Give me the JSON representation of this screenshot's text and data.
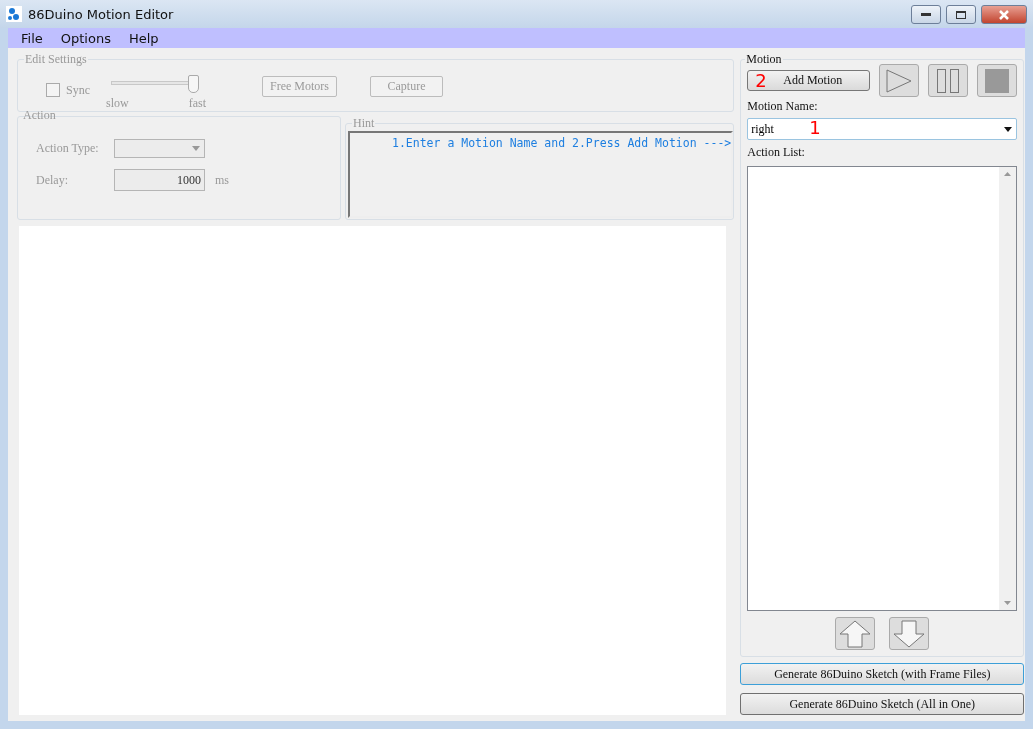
{
  "window": {
    "title": "86Duino Motion Editor"
  },
  "menu": [
    "File",
    "Options",
    "Help"
  ],
  "edit_settings": {
    "title": "Edit Settings",
    "sync": {
      "label": "Sync",
      "checked": false
    },
    "speed": {
      "level": 0.98,
      "min_label": "slow",
      "max_label": "fast"
    },
    "buttons": [
      "Free Motors",
      "Capture"
    ]
  },
  "action": {
    "title": "Action",
    "action_type_label": "Action Type:",
    "delay_label": "Delay:",
    "delay_value": "1000",
    "delay_unit": "ms"
  },
  "hint": {
    "title": "Hint",
    "text": "1.Enter a Motion Name and 2.Press Add Motion --->"
  },
  "motion": {
    "title": "Motion",
    "add_button": "Add Motion",
    "add_annotation": "2",
    "name_label": "Motion Name:",
    "name_value": "right",
    "name_annotation": "1",
    "action_list_label": "Action List:"
  },
  "generate_buttons": [
    {
      "label": "Generate 86Duino Sketch (with Frame Files)",
      "focused": true
    },
    {
      "label": "Generate 86Duino Sketch (All in One)",
      "focused": false
    }
  ]
}
